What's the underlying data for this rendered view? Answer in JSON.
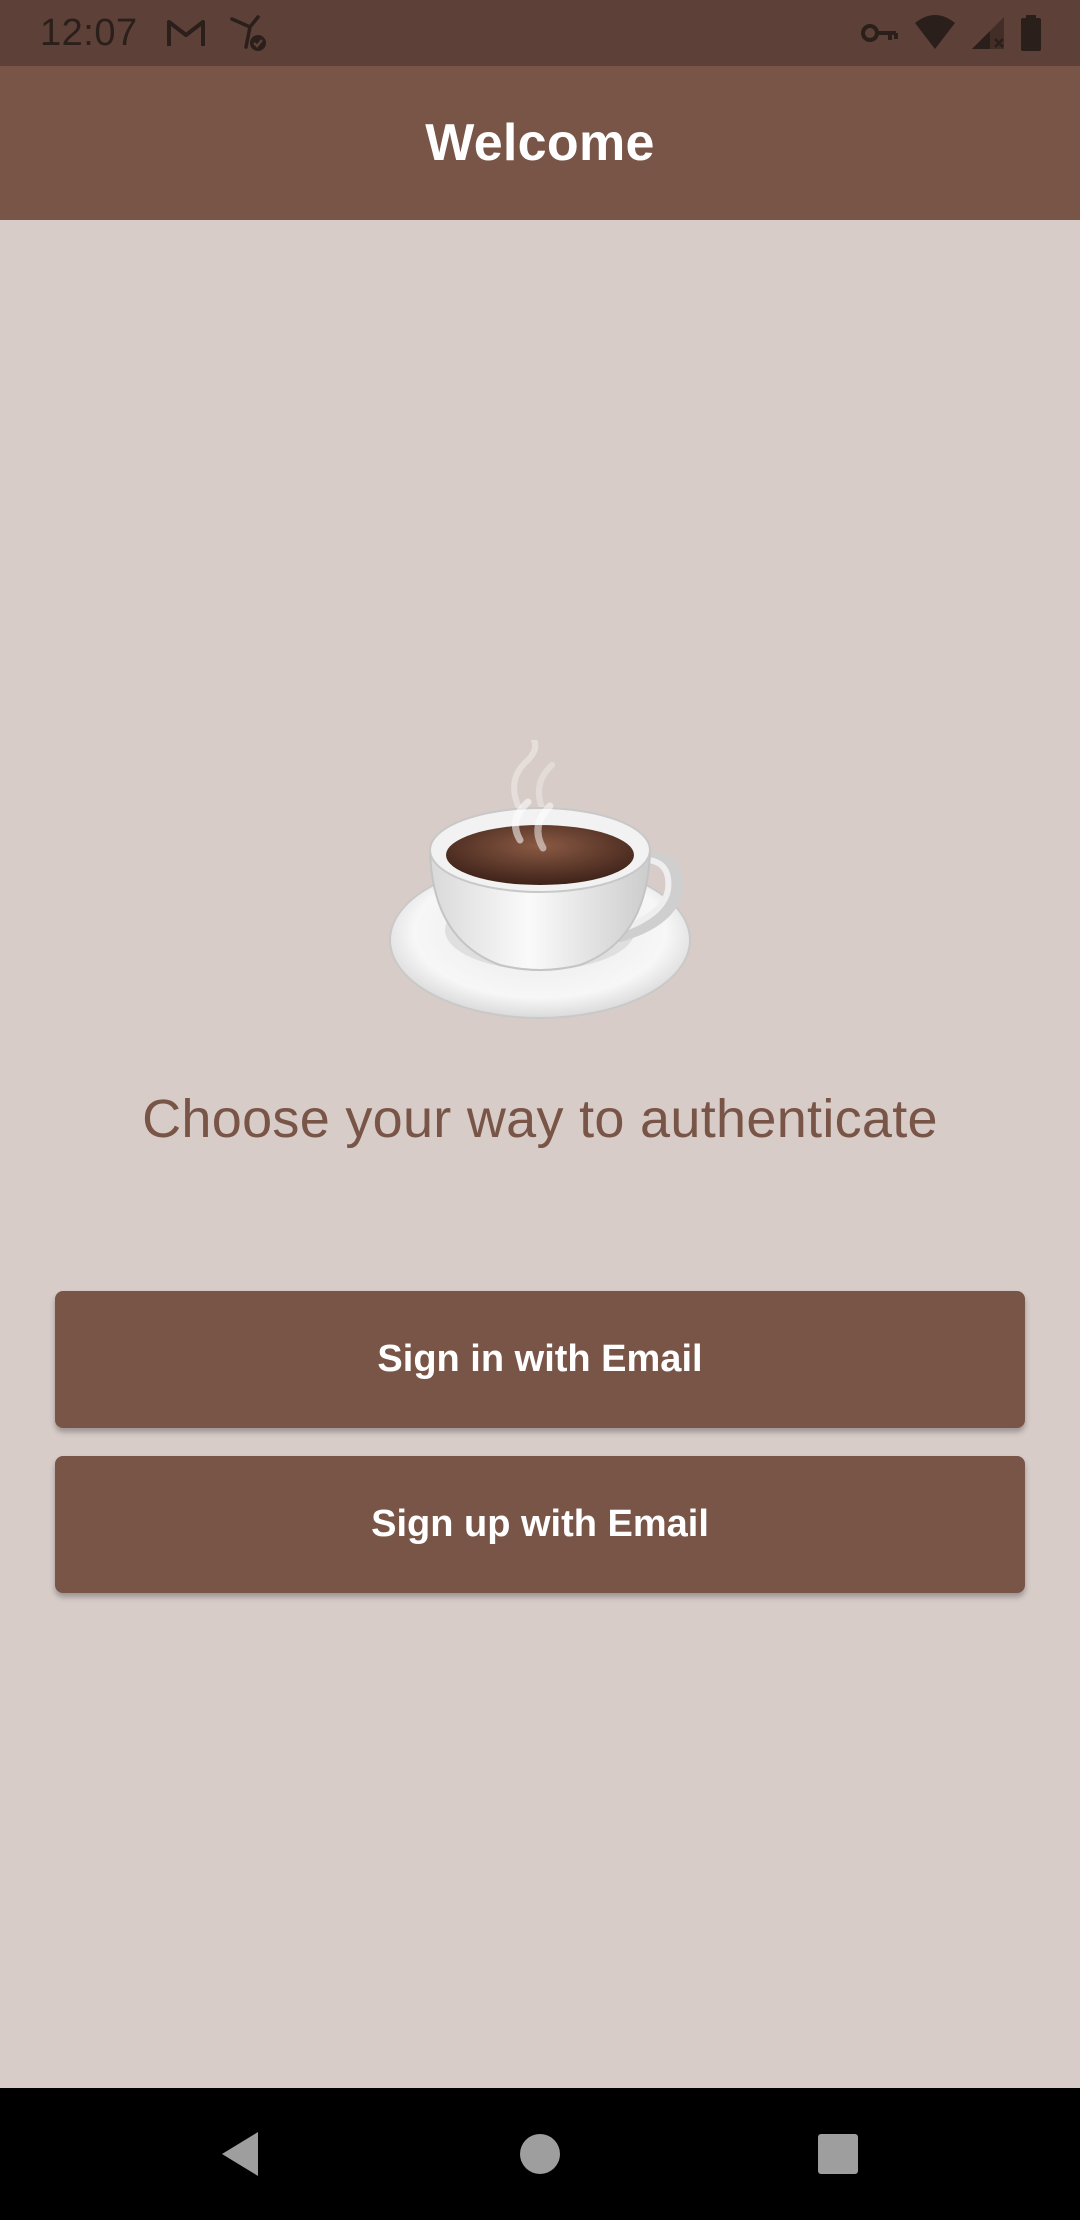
{
  "status_bar": {
    "time": "12:07",
    "left_icons": [
      "gmail-icon",
      "vpn-check-icon"
    ],
    "right_icons": [
      "key-icon",
      "wifi-icon",
      "signal-icon",
      "battery-icon"
    ]
  },
  "app_bar": {
    "title": "Welcome"
  },
  "main": {
    "illustration": "coffee-cup-icon",
    "subtitle": "Choose your way to authenticate",
    "buttons": {
      "sign_in": "Sign in with Email",
      "sign_up": "Sign up with Email"
    }
  },
  "nav_bar": {
    "icons": [
      "back-icon",
      "home-icon",
      "recents-icon"
    ]
  },
  "colors": {
    "status_bar": "#5D4037",
    "primary": "#795548",
    "background": "#D7CCC8",
    "text_on_primary": "#FFFFFF"
  }
}
